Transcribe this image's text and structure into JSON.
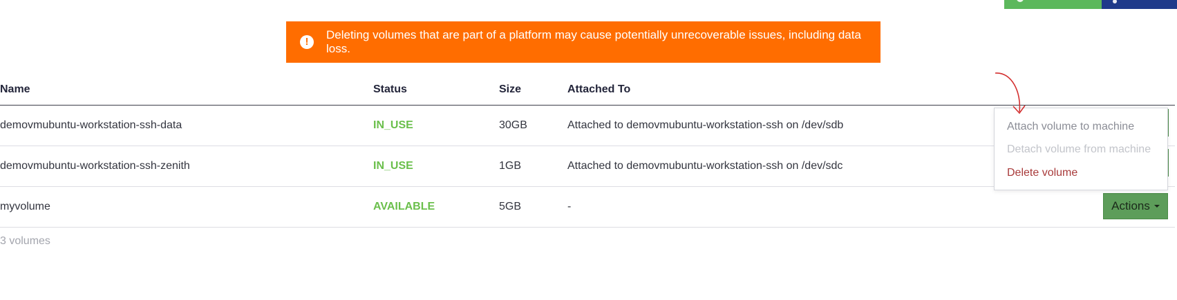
{
  "banner": {
    "icon": "exclamation-circle-icon",
    "text": "Deleting volumes that are part of a platform may cause potentially unrecoverable issues, including data loss."
  },
  "table": {
    "columns": [
      "Name",
      "Status",
      "Size",
      "Attached To"
    ],
    "rows": [
      {
        "name": "demovmubuntu-workstation-ssh-data",
        "status": "IN_USE",
        "size": "30GB",
        "attached": "Attached to demovmubuntu-workstation-ssh on /dev/sdb"
      },
      {
        "name": "demovmubuntu-workstation-ssh-zenith",
        "status": "IN_USE",
        "size": "1GB",
        "attached": "Attached to demovmubuntu-workstation-ssh on /dev/sdc"
      },
      {
        "name": "myvolume",
        "status": "AVAILABLE",
        "size": "5GB",
        "attached": "-"
      }
    ],
    "count": "3 volumes"
  },
  "actions": {
    "label": "Actions",
    "menu": [
      "Attach volume to machine",
      "Detach volume from machine",
      "Delete volume"
    ]
  },
  "colors": {
    "banner": "#ff6d00",
    "status": "#6abf4b",
    "actions": "#5d9d5a",
    "delete": "#a83a3a"
  }
}
